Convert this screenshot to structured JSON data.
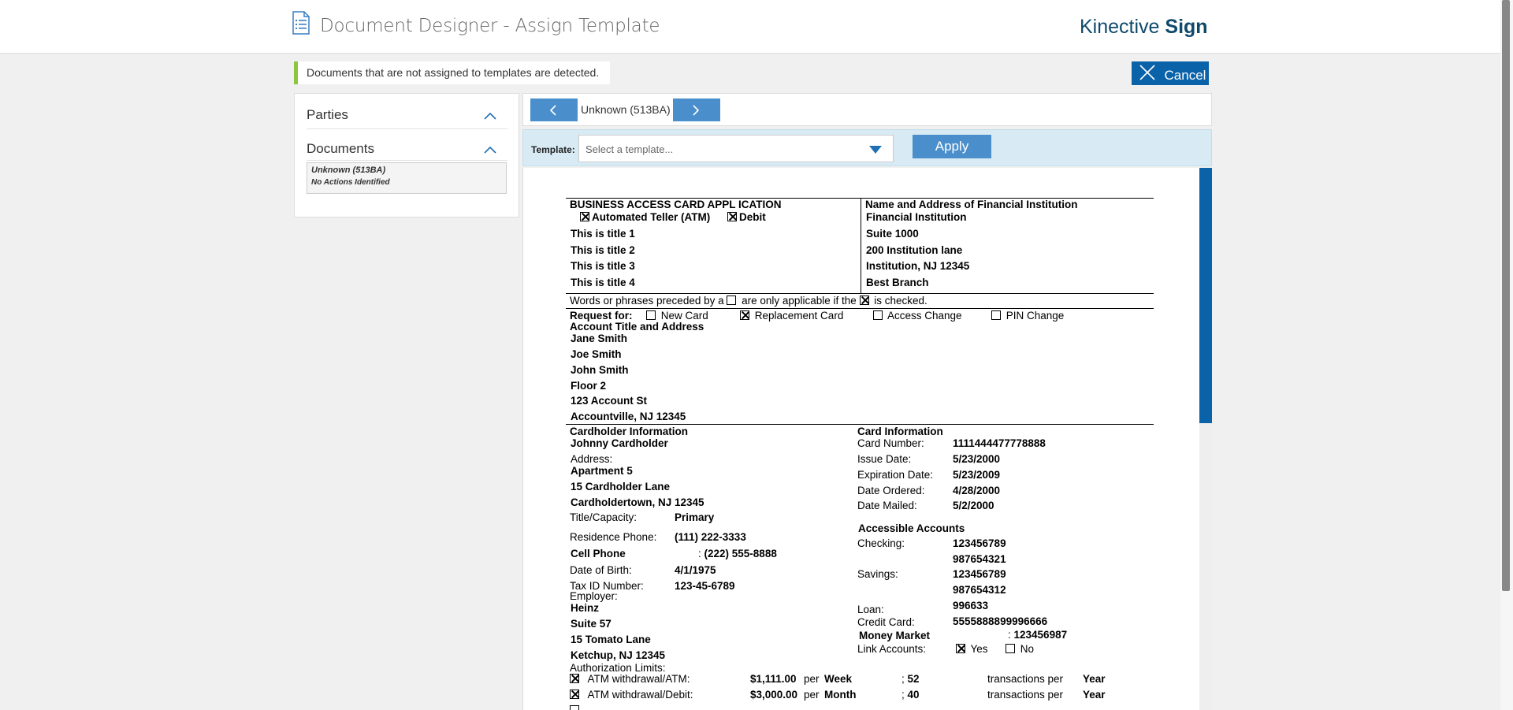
{
  "header": {
    "title": "Document Designer - Assign Template",
    "brand_light": "Kinective",
    "brand_bold": "Sign"
  },
  "alert": {
    "text": "Documents that are not assigned to templates are detected."
  },
  "cancel": {
    "label": "Cancel"
  },
  "sidebar": {
    "parties_label": "Parties",
    "documents_label": "Documents",
    "documents": [
      {
        "name": "Unknown (513BA)",
        "status": "No Actions Identified"
      }
    ]
  },
  "navigator": {
    "current": "Unknown (513BA)"
  },
  "template": {
    "label": "Template:",
    "placeholder": "Select a template...",
    "apply_label": "Apply"
  },
  "document": {
    "heading": "BUSINESS ACCESS CARD APPL ICATION",
    "atm_label": "Automated Teller (ATM)",
    "debit_label": "Debit",
    "titles": [
      "This is title 1",
      "This is title 2",
      "This is title 3",
      "This is title 4"
    ],
    "fi_heading": "Name and Address of Financial Institution",
    "fi_lines": [
      "Financial Institution",
      "Suite 1000",
      "200 Institution lane",
      "Institution, NJ 12345",
      "Best Branch"
    ],
    "words_note_a": "Words or phrases preceded by a",
    "words_note_b": "are only applicable if the",
    "words_note_c": "is checked.",
    "request_label": "Request for:",
    "request_options": [
      {
        "label": "New Card",
        "checked": false
      },
      {
        "label": "Replacement Card",
        "checked": true
      },
      {
        "label": "Access Change",
        "checked": false
      },
      {
        "label": "PIN Change",
        "checked": false
      }
    ],
    "account_heading": "Account Title and Address",
    "account_lines": [
      "Jane Smith",
      "Joe Smith",
      "John Smith",
      "Floor 2",
      "123 Account St",
      "Accountville, NJ 12345"
    ],
    "cardholder_heading": "Cardholder Information",
    "cardholder_name": "Johnny Cardholder",
    "address_label": "Address:",
    "address_lines": [
      "Apartment 5",
      "15 Cardholder Lane",
      "Cardholdertown, NJ 12345"
    ],
    "title_capacity_label": "Title/Capacity:",
    "title_capacity": "Primary",
    "residence_phone_label": "Residence Phone:",
    "residence_phone": "(111) 222-3333",
    "cell_phone_label": "Cell Phone",
    "cell_phone": "(222) 555-8888",
    "dob_label": "Date of Birth:",
    "dob": "4/1/1975",
    "taxid_label": "Tax ID Number:",
    "taxid": "123-45-6789",
    "employer_label": "Employer:",
    "employer_lines": [
      "Heinz",
      "Suite 57",
      "15 Tomato Lane",
      "Ketchup, NJ 12345"
    ],
    "auth_limits_label": "Authorization Limits:",
    "limits": [
      {
        "label": "ATM withdrawal/ATM:",
        "amount": "$1,111.00",
        "period": "Week",
        "count": "52",
        "per": "Year"
      },
      {
        "label": "ATM withdrawal/Debit:",
        "amount": "$3,000.00",
        "period": "Month",
        "count": "40",
        "per": "Year"
      }
    ],
    "per_label": "per",
    "transactions_label": "transactions per",
    "card_heading": "Card Information",
    "card_fields": [
      {
        "label": "Card Number:",
        "value": "1111444477778888"
      },
      {
        "label": "Issue Date:",
        "value": "5/23/2000"
      },
      {
        "label": "Expiration Date:",
        "value": "5/23/2009"
      },
      {
        "label": "Date Ordered:",
        "value": "4/28/2000"
      },
      {
        "label": "Date Mailed:",
        "value": "5/2/2000"
      }
    ],
    "accessible_heading": "Accessible Accounts",
    "checking_label": "Checking:",
    "checking": [
      "123456789",
      "987654321"
    ],
    "savings_label": "Savings:",
    "savings": [
      "123456789",
      "987654312"
    ],
    "loan_label": "Loan:",
    "loan": "996633",
    "credit_label": "Credit Card:",
    "credit": "5555888899996666",
    "money_market_label": "Money Market",
    "money_market": "123456987",
    "link_label": "Link Accounts:",
    "link_yes": "Yes",
    "link_no": "No"
  }
}
